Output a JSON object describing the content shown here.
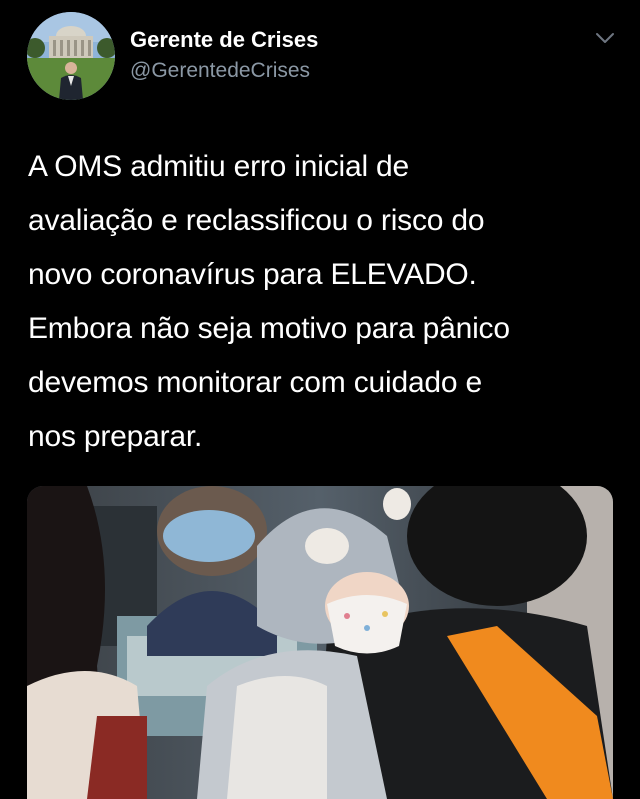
{
  "user": {
    "display_name": "Gerente de Crises",
    "handle": "@GerentedeCrises",
    "avatar_icon": "profile-photo"
  },
  "menu": {
    "icon": "chevron-down-icon"
  },
  "tweet": {
    "text_lines": [
      "A OMS admitiu erro inicial de",
      "avaliação e reclassificou o risco do",
      "novo coronavírus para ELEVADO.",
      "Embora não seja motivo para pânico",
      "devemos monitorar com cuidado e",
      "nos preparar."
    ]
  },
  "media": {
    "icon": "attached-photo"
  },
  "colors": {
    "background": "#000000",
    "text": "#ffffff",
    "secondary_text": "#8b98a5"
  }
}
